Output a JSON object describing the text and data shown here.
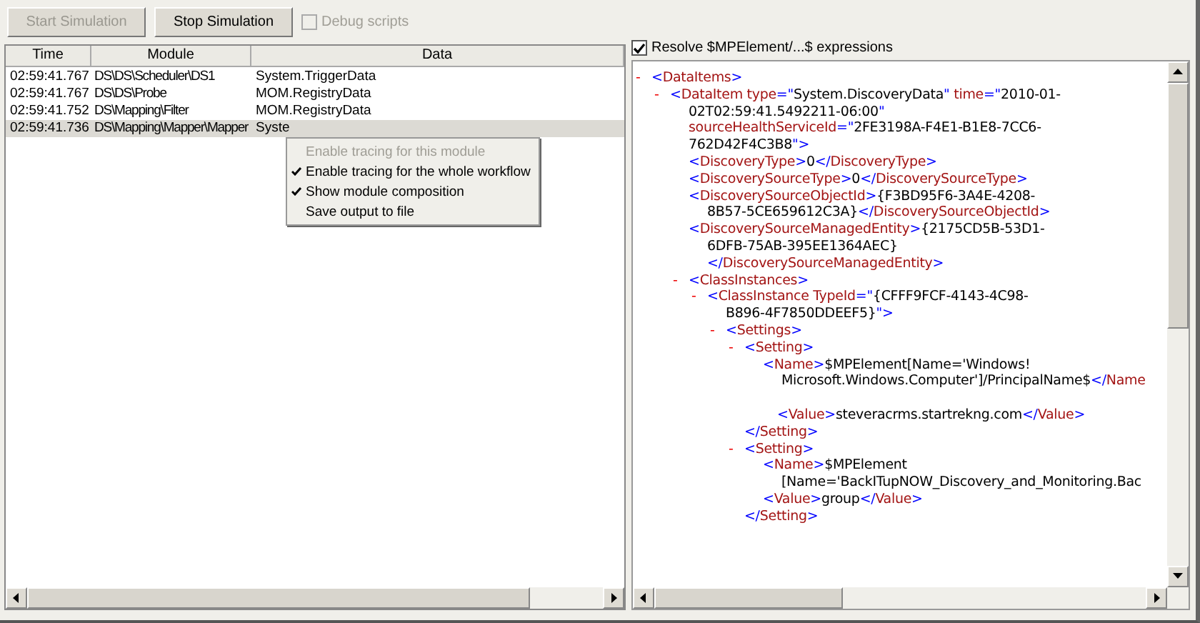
{
  "toolbar": {
    "buttons": [
      {
        "label": "Start Simulation",
        "disabled": true
      },
      {
        "label": "Stop Simulation",
        "disabled": false
      }
    ],
    "debug_checkbox": {
      "label": "Debug scripts",
      "checked": false,
      "disabled": true
    }
  },
  "trace_table": {
    "columns": [
      "Time",
      "Module",
      "Data"
    ],
    "rows": [
      {
        "time": "02:59:41.767",
        "module": "DS\\DS\\Scheduler\\DS1",
        "data": "System.TriggerData",
        "selected": false
      },
      {
        "time": "02:59:41.767",
        "module": "DS\\DS\\Probe",
        "data": "MOM.RegistryData",
        "selected": false
      },
      {
        "time": "02:59:41.752",
        "module": "DS\\Mapping\\Filter",
        "data": "MOM.RegistryData",
        "selected": false
      },
      {
        "time": "02:59:41.736",
        "module": "DS\\Mapping\\Mapper\\Mapper",
        "data": "Syste",
        "selected": true
      }
    ]
  },
  "context_menu": {
    "items": [
      {
        "label": "Enable tracing for this module",
        "checked": false,
        "disabled": true
      },
      {
        "label": "Enable tracing for the whole workflow",
        "checked": true,
        "disabled": false
      },
      {
        "label": "Show module composition",
        "checked": true,
        "disabled": false
      },
      {
        "label": "Save output to file",
        "checked": false,
        "disabled": false
      }
    ]
  },
  "resolve_checkbox": {
    "label": "Resolve $MPElement/...$ expressions",
    "checked": true
  },
  "xml_view": {
    "nodes": [
      {
        "collapsible": true,
        "lines": [
          [
            {
              "kind": "b",
              "text": "<"
            },
            {
              "kind": "t",
              "text": "DataItems"
            },
            {
              "kind": "b",
              "text": ">"
            }
          ]
        ],
        "children": [
          {
            "collapsible": true,
            "lines": [
              [
                {
                  "kind": "b",
                  "text": "<"
                },
                {
                  "kind": "t",
                  "text": "DataItem type"
                },
                {
                  "kind": "b",
                  "text": "=\""
                },
                {
                  "kind": "v",
                  "text": "System.DiscoveryData"
                },
                {
                  "kind": "b",
                  "text": "\""
                },
                {
                  "kind": "t",
                  "text": " time"
                },
                {
                  "kind": "b",
                  "text": "=\""
                },
                {
                  "kind": "v",
                  "text": "2010-01-"
                }
              ],
              [
                {
                  "kind": "v",
                  "text": "02T02:59:41.5492211-06:00"
                },
                {
                  "kind": "b",
                  "text": "\""
                }
              ],
              [
                {
                  "kind": "t",
                  "text": "sourceHealthServiceId"
                },
                {
                  "kind": "b",
                  "text": "=\""
                },
                {
                  "kind": "v",
                  "text": "2FE3198A-F4E1-B1E8-7CC6-"
                }
              ],
              [
                {
                  "kind": "v",
                  "text": "762D42F4C3B8"
                },
                {
                  "kind": "b",
                  "text": "\">"
                }
              ]
            ],
            "children": [
              {
                "collapsible": false,
                "lines": [
                  [
                    {
                      "kind": "b",
                      "text": "<"
                    },
                    {
                      "kind": "t",
                      "text": "DiscoveryType"
                    },
                    {
                      "kind": "b",
                      "text": ">"
                    },
                    {
                      "kind": "v",
                      "text": "0"
                    },
                    {
                      "kind": "b",
                      "text": "</"
                    },
                    {
                      "kind": "t",
                      "text": "DiscoveryType"
                    },
                    {
                      "kind": "b",
                      "text": ">"
                    }
                  ]
                ]
              },
              {
                "collapsible": false,
                "lines": [
                  [
                    {
                      "kind": "b",
                      "text": "<"
                    },
                    {
                      "kind": "t",
                      "text": "DiscoverySourceType"
                    },
                    {
                      "kind": "b",
                      "text": ">"
                    },
                    {
                      "kind": "v",
                      "text": "0"
                    },
                    {
                      "kind": "b",
                      "text": "</"
                    },
                    {
                      "kind": "t",
                      "text": "DiscoverySourceType"
                    },
                    {
                      "kind": "b",
                      "text": ">"
                    }
                  ]
                ]
              },
              {
                "collapsible": false,
                "lines": [
                  [
                    {
                      "kind": "b",
                      "text": "<"
                    },
                    {
                      "kind": "t",
                      "text": "DiscoverySourceObjectId"
                    },
                    {
                      "kind": "b",
                      "text": ">"
                    },
                    {
                      "kind": "v",
                      "text": "{F3BD95F6-3A4E-4208-"
                    }
                  ],
                  [
                    {
                      "kind": "v",
                      "text": "8B57-5CE659612C3A}"
                    },
                    {
                      "kind": "b",
                      "text": "</"
                    },
                    {
                      "kind": "t",
                      "text": "DiscoverySourceObjectId"
                    },
                    {
                      "kind": "b",
                      "text": ">"
                    }
                  ]
                ]
              },
              {
                "collapsible": false,
                "lines": [
                  [
                    {
                      "kind": "b",
                      "text": "<"
                    },
                    {
                      "kind": "t",
                      "text": "DiscoverySourceManagedEntity"
                    },
                    {
                      "kind": "b",
                      "text": ">"
                    },
                    {
                      "kind": "v",
                      "text": "{2175CD5B-53D1-"
                    }
                  ],
                  [
                    {
                      "kind": "v",
                      "text": "6DFB-75AB-395EE1364AEC}"
                    }
                  ],
                  [
                    {
                      "kind": "b",
                      "text": "</"
                    },
                    {
                      "kind": "t",
                      "text": "DiscoverySourceManagedEntity"
                    },
                    {
                      "kind": "b",
                      "text": ">"
                    }
                  ]
                ]
              },
              {
                "collapsible": true,
                "lines": [
                  [
                    {
                      "kind": "b",
                      "text": "<"
                    },
                    {
                      "kind": "t",
                      "text": "ClassInstances"
                    },
                    {
                      "kind": "b",
                      "text": ">"
                    }
                  ]
                ],
                "children": [
                  {
                    "collapsible": true,
                    "lines": [
                      [
                        {
                          "kind": "b",
                          "text": "<"
                        },
                        {
                          "kind": "t",
                          "text": "ClassInstance TypeId"
                        },
                        {
                          "kind": "b",
                          "text": "=\""
                        },
                        {
                          "kind": "v",
                          "text": "{CFFF9FCF-4143-4C98-"
                        }
                      ],
                      [
                        {
                          "kind": "v",
                          "text": "B896-4F7850DDEEF5}"
                        },
                        {
                          "kind": "b",
                          "text": "\">"
                        }
                      ]
                    ],
                    "children": [
                      {
                        "collapsible": true,
                        "lines": [
                          [
                            {
                              "kind": "b",
                              "text": "<"
                            },
                            {
                              "kind": "t",
                              "text": "Settings"
                            },
                            {
                              "kind": "b",
                              "text": ">"
                            }
                          ]
                        ],
                        "children": [
                          {
                            "collapsible": true,
                            "lines": [
                              [
                                {
                                  "kind": "b",
                                  "text": "<"
                                },
                                {
                                  "kind": "t",
                                  "text": "Setting"
                                },
                                {
                                  "kind": "b",
                                  "text": ">"
                                }
                              ]
                            ],
                            "children": [
                              {
                                "collapsible": false,
                                "lines": [
                                  [
                                    {
                                      "kind": "b",
                                      "text": "<"
                                    },
                                    {
                                      "kind": "t",
                                      "text": "Name"
                                    },
                                    {
                                      "kind": "b",
                                      "text": ">"
                                    },
                                    {
                                      "kind": "v",
                                      "text": "$MPElement[Name='Windows!"
                                    }
                                  ],
                                  [
                                    {
                                      "kind": "v",
                                      "text": "Microsoft.Windows.Computer']/PrincipalName$"
                                    },
                                    {
                                      "kind": "b",
                                      "text": "</"
                                    },
                                    {
                                      "kind": "t",
                                      "text": "Name"
                                    }
                                  ]
                                ]
                              },
                              {
                                "collapsible": false,
                                "spaced": true,
                                "lines": [
                                  [
                                    {
                                      "kind": "b",
                                      "text": "<"
                                    },
                                    {
                                      "kind": "t",
                                      "text": "Value"
                                    },
                                    {
                                      "kind": "b",
                                      "text": ">"
                                    },
                                    {
                                      "kind": "v",
                                      "text": "steveracrms.startrekng.com"
                                    },
                                    {
                                      "kind": "b",
                                      "text": "</"
                                    },
                                    {
                                      "kind": "t",
                                      "text": "Value"
                                    },
                                    {
                                      "kind": "b",
                                      "text": ">"
                                    }
                                  ]
                                ]
                              }
                            ],
                            "close": [
                              {
                                "kind": "b",
                                "text": "</"
                              },
                              {
                                "kind": "t",
                                "text": "Setting"
                              },
                              {
                                "kind": "b",
                                "text": ">"
                              }
                            ]
                          },
                          {
                            "collapsible": true,
                            "lines": [
                              [
                                {
                                  "kind": "b",
                                  "text": "<"
                                },
                                {
                                  "kind": "t",
                                  "text": "Setting"
                                },
                                {
                                  "kind": "b",
                                  "text": ">"
                                }
                              ]
                            ],
                            "children": [
                              {
                                "collapsible": false,
                                "lines": [
                                  [
                                    {
                                      "kind": "b",
                                      "text": "<"
                                    },
                                    {
                                      "kind": "t",
                                      "text": "Name"
                                    },
                                    {
                                      "kind": "b",
                                      "text": ">"
                                    },
                                    {
                                      "kind": "v",
                                      "text": "$MPElement"
                                    }
                                  ],
                                  [
                                    {
                                      "kind": "v",
                                      "text": "[Name='BackITupNOW_Discovery_and_Monitoring.Bac"
                                    }
                                  ]
                                ]
                              },
                              {
                                "collapsible": false,
                                "lines": [
                                  [
                                    {
                                      "kind": "b",
                                      "text": "<"
                                    },
                                    {
                                      "kind": "t",
                                      "text": "Value"
                                    },
                                    {
                                      "kind": "b",
                                      "text": ">"
                                    },
                                    {
                                      "kind": "v",
                                      "text": "group"
                                    },
                                    {
                                      "kind": "b",
                                      "text": "</"
                                    },
                                    {
                                      "kind": "t",
                                      "text": "Value"
                                    },
                                    {
                                      "kind": "b",
                                      "text": ">"
                                    }
                                  ]
                                ]
                              }
                            ],
                            "close": [
                              {
                                "kind": "b",
                                "text": "</"
                              },
                              {
                                "kind": "t",
                                "text": "Setting"
                              },
                              {
                                "kind": "b",
                                "text": ">"
                              }
                            ]
                          }
                        ]
                      }
                    ]
                  }
                ]
              }
            ]
          }
        ]
      }
    ]
  },
  "collapse_sign": "-"
}
